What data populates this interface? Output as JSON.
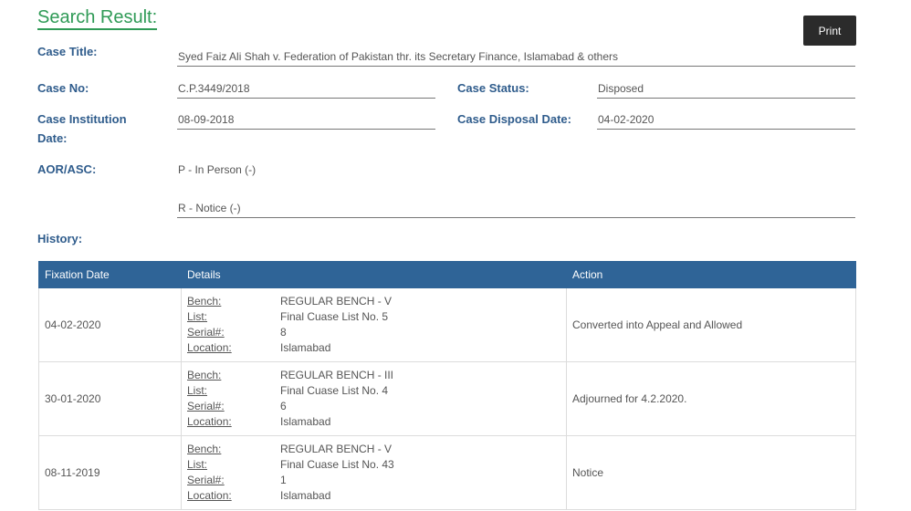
{
  "page": {
    "title": "Search Result:",
    "print_label": "Print"
  },
  "case": {
    "title_label": "Case Title:",
    "title_value": "Syed Faiz Ali Shah v. Federation of Pakistan thr. its Secretary Finance, Islamabad & others",
    "no_label": "Case No:",
    "no_value": "C.P.3449/2018",
    "status_label": "Case Status:",
    "status_value": "Disposed",
    "institution_label_1": "Case Institution",
    "institution_label_2": "Date:",
    "institution_value": "08-09-2018",
    "disposal_label": "Case Disposal Date:",
    "disposal_value": "04-02-2020",
    "aor_label": "AOR/ASC:",
    "aor_p": "P - In Person (-)",
    "aor_r": "R - Notice (-)",
    "history_label": "History:"
  },
  "history": {
    "headers": [
      "Fixation Date",
      "Details",
      "Action"
    ],
    "detail_keys": [
      "Bench:",
      "List:",
      "Serial#:",
      "Location:"
    ],
    "rows": [
      {
        "date": "04-02-2020",
        "bench": "REGULAR BENCH - V",
        "list": "Final Cuase List No. 5",
        "serial": "8",
        "location": "Islamabad",
        "action": "Converted into Appeal and Allowed"
      },
      {
        "date": "30-01-2020",
        "bench": "REGULAR BENCH - III",
        "list": "Final Cuase List No. 4",
        "serial": "6",
        "location": "Islamabad",
        "action": "Adjourned for 4.2.2020."
      },
      {
        "date": "08-11-2019",
        "bench": "REGULAR BENCH - V",
        "list": "Final Cuase List No. 43",
        "serial": "1",
        "location": "Islamabad",
        "action": "Notice"
      }
    ]
  }
}
